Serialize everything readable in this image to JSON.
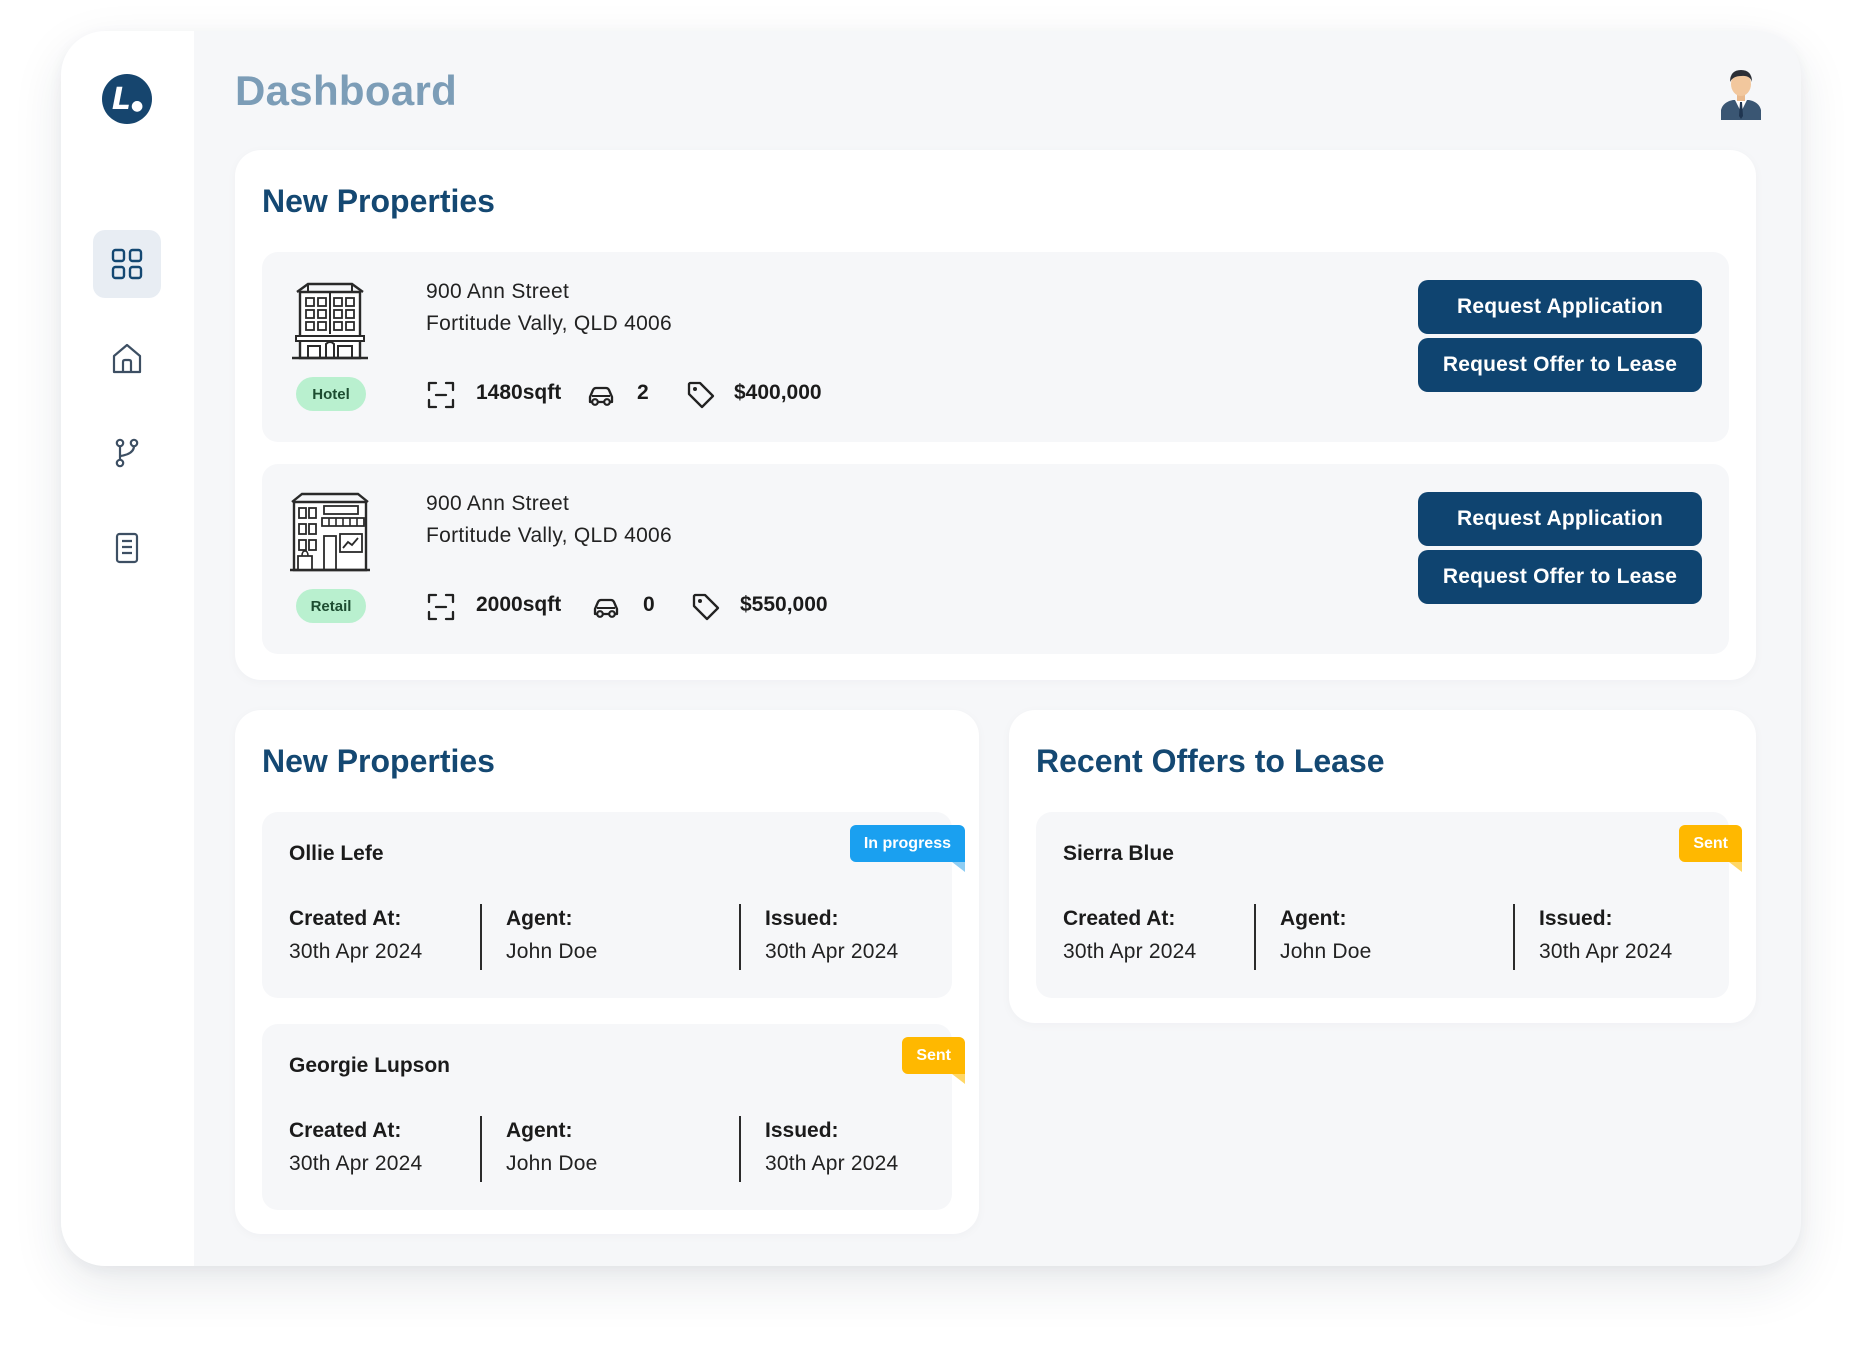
{
  "header": {
    "title": "Dashboard"
  },
  "colors": {
    "primary": "#0f4470",
    "title_muted": "#7c9db7",
    "badge_green": "#b9f0cf",
    "tag_blue": "#1aa0f0",
    "tag_yellow": "#ffb800"
  },
  "sidebar": {
    "logo_letter": "L",
    "items": [
      {
        "icon": "dashboard-grid-icon",
        "active": true
      },
      {
        "icon": "home-icon",
        "active": false
      },
      {
        "icon": "branch-icon",
        "active": false
      },
      {
        "icon": "document-icon",
        "active": false
      }
    ]
  },
  "new_properties": {
    "title": "New Properties",
    "items": [
      {
        "type": "Hotel",
        "address_line1": "900 Ann Street",
        "address_line2": "Fortitude Vally, QLD 4006",
        "area": "1480sqft",
        "parking": "2",
        "price": "$400,000",
        "btn_application": "Request Application",
        "btn_offer": "Request Offer to Lease"
      },
      {
        "type": "Retail",
        "address_line1": "900 Ann Street",
        "address_line2": "Fortitude Vally, QLD 4006",
        "area": "2000sqft",
        "parking": "0",
        "price": "$550,000",
        "btn_application": "Request Application",
        "btn_offer": "Request Offer to Lease"
      }
    ]
  },
  "applications": {
    "title": "New Properties",
    "items": [
      {
        "name": "Ollie Lefe",
        "status": "In progress",
        "created_label": "Created At:",
        "created": "30th Apr 2024",
        "agent_label": "Agent:",
        "agent": "John Doe",
        "issued_label": "Issued:",
        "issued": "30th Apr 2024"
      },
      {
        "name": "Georgie Lupson",
        "status": "Sent",
        "created_label": "Created At:",
        "created": "30th Apr 2024",
        "agent_label": "Agent:",
        "agent": "John Doe",
        "issued_label": "Issued:",
        "issued": "30th Apr 2024"
      }
    ]
  },
  "offers": {
    "title": "Recent Offers to Lease",
    "items": [
      {
        "name": "Sierra Blue",
        "status": "Sent",
        "created_label": "Created At:",
        "created": "30th Apr 2024",
        "agent_label": "Agent:",
        "agent": "John Doe",
        "issued_label": "Issued:",
        "issued": "30th Apr 2024"
      }
    ]
  }
}
